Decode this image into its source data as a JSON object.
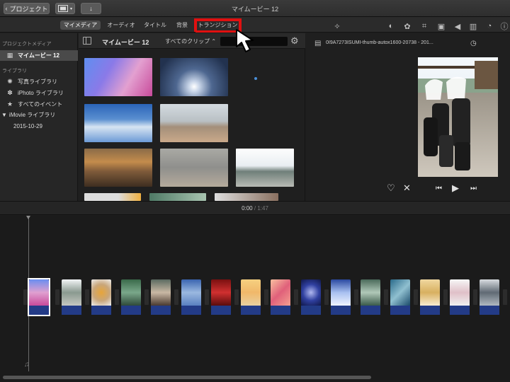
{
  "window": {
    "title": "マイムービー 12"
  },
  "toolbar": {
    "back_label": "プロジェクト",
    "media_icon": "film-icon",
    "import_icon": "import-arrow-icon"
  },
  "tabs": [
    {
      "label": "マイメディア",
      "active": true
    },
    {
      "label": "オーディオ"
    },
    {
      "label": "タイトル"
    },
    {
      "label": "背景"
    },
    {
      "label": "トランジション",
      "highlighted": true
    }
  ],
  "highlight_color": "#e01010",
  "sidebar": {
    "project_media_header": "プロジェクトメディア",
    "project_item": "マイムービー 12",
    "library_header": "ライブラリ",
    "photos_item": "写真ライブラリ",
    "iphoto_item": "iPhoto ライブラリ",
    "all_events_item": "すべてのイベント",
    "imovie_library": "iMovie ライブラリ",
    "event_date": "2015-10-29"
  },
  "browser": {
    "title": "マイムービー 12",
    "filter_label": "すべてのクリップ"
  },
  "viewer": {
    "filename": "0I9A7273ISUMI-thumb-autox1600-20738 - 201..."
  },
  "timeline": {
    "current_time": "0:00",
    "separator": "/",
    "total_time": "1:47"
  },
  "accent_colors": {
    "audio_track": "#233b87",
    "selected_border": "#ffffff"
  }
}
